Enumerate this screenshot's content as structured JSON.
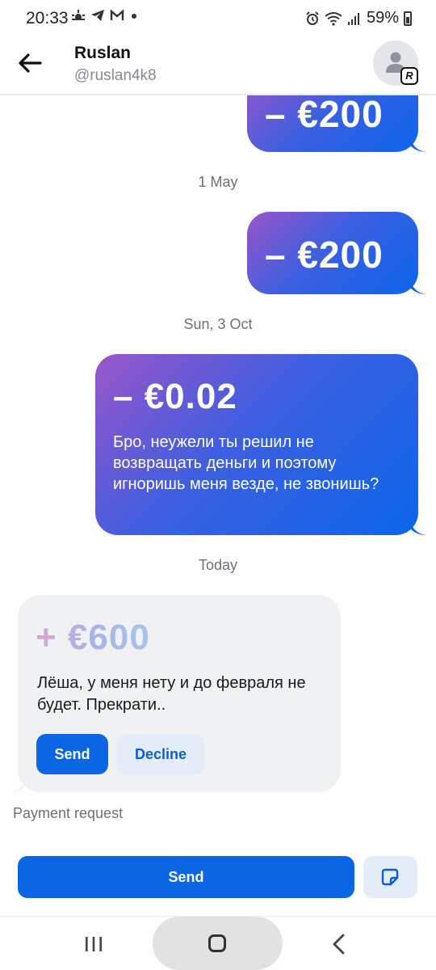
{
  "status_bar": {
    "time": "20:33",
    "battery": "59%",
    "left_icons": [
      "weather-icon",
      "telegram-icon",
      "gmail-icon",
      "dot-icon"
    ],
    "right_icons": [
      "alarm-icon",
      "wifi-icon",
      "signal-icon",
      "battery-icon"
    ]
  },
  "header": {
    "name": "Ruslan",
    "handle": "@ruslan4k8",
    "avatar_badge": "R"
  },
  "messages": [
    {
      "amount": "– €200"
    },
    {
      "date": "1 May",
      "amount": "– €200"
    },
    {
      "date": "Sun, 3 Oct",
      "amount": "– €0.02",
      "text": "Бро, неужели ты решил не возвращать деньги и поэтому игноришь меня везде, не звонишь?"
    },
    {
      "date": "Today",
      "amount": "+ €600",
      "text": "Лёша, у меня нету и до февраля не будет. Прекрати..",
      "send_label": "Send",
      "decline_label": "Decline",
      "caption": "Payment request"
    }
  ],
  "bottom": {
    "send_label": "Send"
  },
  "colors": {
    "accent": "#0b66e4",
    "gradient_start": "#9a55c8",
    "gradient_end": "#0c66ea",
    "incoming_bg": "#f0f1f3"
  }
}
